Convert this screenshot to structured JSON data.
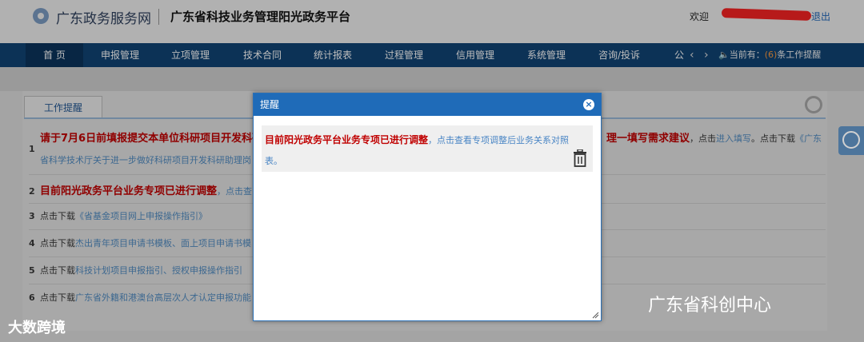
{
  "header": {
    "site_name": "广东政务服务网",
    "platform_name": "广东省科技业务管理阳光政务平台",
    "welcome": "欢迎",
    "logout": "退出"
  },
  "nav": {
    "items": [
      "首 页",
      "申报管理",
      "立项管理",
      "技术合同",
      "统计报表",
      "过程管理",
      "信用管理",
      "系统管理",
      "咨询/投诉",
      "公"
    ],
    "notice_prefix": "当前有：",
    "notice_count": "(6)",
    "notice_suffix": "条工作提醒"
  },
  "tab": {
    "label": "工作提醒"
  },
  "rows": [
    {
      "num": "1",
      "strong": "请于7月6日前填报提交本单位科研项目开发科研",
      "strong2": "理一填写需求建议",
      "tail_text": "，点击",
      "tail_link": "进入填写",
      "tail_text2": "。点击下载",
      "tail_link2": "《广东",
      "line2_link": "省科学技术厅关于进一步做好科研项目开发科研助理岗"
    },
    {
      "num": "2",
      "strong": "目前阳光政务平台业务专项已进行调整",
      "tail_text": "，点击查"
    },
    {
      "num": "3",
      "text": "点击下载",
      "link": "《省基金项目网上申报操作指引》"
    },
    {
      "num": "4",
      "text": "点击下载",
      "link": "杰出青年项目申请书模板、面上项目申请书模"
    },
    {
      "num": "5",
      "text": "点击下载",
      "link": "科技计划项目申报指引、授权申报操作指引"
    },
    {
      "num": "6",
      "text": "点击下载",
      "link": "广东省外籍和港澳台高层次人才认定申报功能"
    }
  ],
  "dialog": {
    "title": "提醒",
    "message_strong": "目前阳光政务平台业务专项已进行调整",
    "message_link_1": "，点击查看专项调整后业务关系对照",
    "message_link_2": "表。"
  },
  "watermarks": {
    "left": "大数跨境",
    "right": "广东省科创中心"
  },
  "colors": {
    "nav_bg": "#0f3d6a",
    "dialog_header": "#1f6bb8",
    "alert_red": "#c00000"
  }
}
